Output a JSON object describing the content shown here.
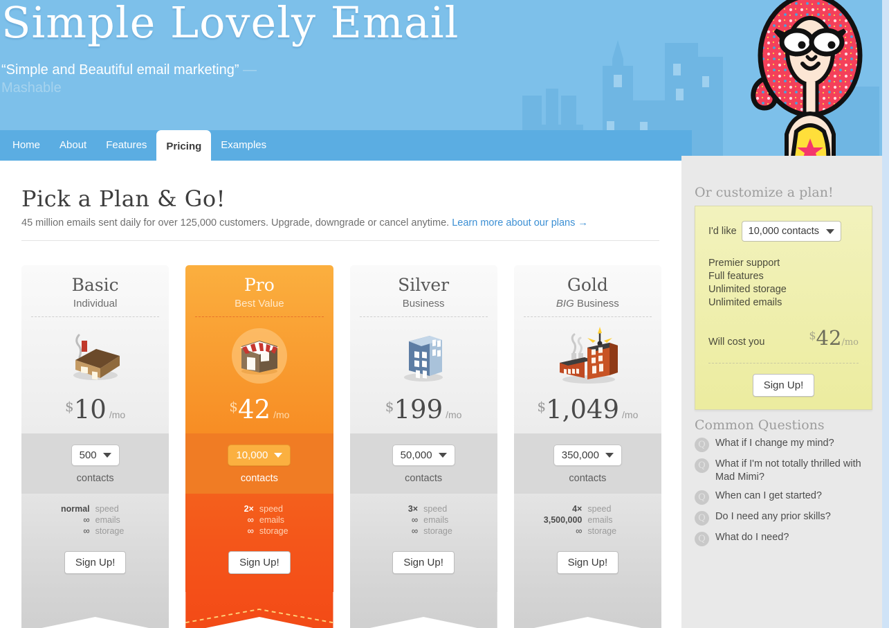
{
  "hero": {
    "brand": "Simple Lovely Email",
    "tagline_quote": "“Simple and Beautiful email marketing”",
    "tagline_dash": " — ",
    "tagline_source": "Mashable"
  },
  "nav": {
    "tabs": [
      {
        "label": "Home",
        "active": false
      },
      {
        "label": "About",
        "active": false
      },
      {
        "label": "Features",
        "active": false
      },
      {
        "label": "Pricing",
        "active": true
      },
      {
        "label": "Examples",
        "active": false
      }
    ]
  },
  "main": {
    "title": "Pick a Plan & Go!",
    "subtitle": "45 million emails sent daily for over 125,000 customers. Upgrade, downgrade or cancel anytime.",
    "learn_more": "Learn more about our plans →"
  },
  "plans": [
    {
      "name": "Basic",
      "subtitle": "Individual",
      "subtitle_emphasis": "",
      "icon": "house-icon",
      "currency": "$",
      "price": "10",
      "period": "/mo",
      "contacts_value": "500",
      "contacts_label": "contacts",
      "specs": [
        {
          "value": "normal",
          "key": "speed"
        },
        {
          "value": "∞",
          "key": "emails"
        },
        {
          "value": "∞",
          "key": "storage"
        }
      ],
      "cta": "Sign Up!",
      "featured": false
    },
    {
      "name": "Pro",
      "subtitle": "Best Value",
      "subtitle_emphasis": "",
      "icon": "shop-icon",
      "currency": "$",
      "price": "42",
      "period": "/mo",
      "contacts_value": "10,000",
      "contacts_label": "contacts",
      "specs": [
        {
          "value": "2×",
          "key": "speed"
        },
        {
          "value": "∞",
          "key": "emails"
        },
        {
          "value": "∞",
          "key": "storage"
        }
      ],
      "cta": "Sign Up!",
      "featured": true
    },
    {
      "name": "Silver",
      "subtitle": "Business",
      "subtitle_emphasis": "",
      "icon": "office-building-icon",
      "currency": "$",
      "price": "199",
      "period": "/mo",
      "contacts_value": "50,000",
      "contacts_label": "contacts",
      "specs": [
        {
          "value": "3×",
          "key": "speed"
        },
        {
          "value": "∞",
          "key": "emails"
        },
        {
          "value": "∞",
          "key": "storage"
        }
      ],
      "cta": "Sign Up!",
      "featured": false
    },
    {
      "name": "Gold",
      "subtitle": "Business",
      "subtitle_emphasis": "BIG",
      "icon": "factory-icon",
      "currency": "$",
      "price": "1,049",
      "period": "/mo",
      "contacts_value": "350,000",
      "contacts_label": "contacts",
      "specs": [
        {
          "value": "4×",
          "key": "speed"
        },
        {
          "value": "3,500,000",
          "key": "emails"
        },
        {
          "value": "∞",
          "key": "storage"
        }
      ],
      "cta": "Sign Up!",
      "featured": false
    }
  ],
  "sidebar": {
    "customize_heading": "Or customize a plan!",
    "ild_like_label": "I'd like",
    "contacts_select_value": "10,000 contacts",
    "features": [
      "Premier support",
      "Full features",
      "Unlimited storage",
      "Unlimited emails"
    ],
    "cost_label": "Will cost you",
    "cost_currency": "$",
    "cost_amount": "42",
    "cost_period": "/mo",
    "cost_cta": "Sign Up!",
    "faq_heading": "Common Questions",
    "faq_badge": "Q",
    "faq_items": [
      "What if I change my mind?",
      "What if I'm not totally thrilled with Mad Mimi?",
      "When can I get started?",
      "Do I need any prior skills?",
      "What do I need?"
    ]
  },
  "colors": {
    "hero_blue": "#7dc0ea",
    "nav_blue": "#5bade2",
    "page_blue": "#cfe3f7",
    "featured_orange_top": "#fbaf3f",
    "featured_orange_bottom": "#f4531a",
    "link_blue": "#3b8fd4",
    "customize_yellow": "#eeee a8",
    "sidebar_gray": "#e9e9e9"
  }
}
